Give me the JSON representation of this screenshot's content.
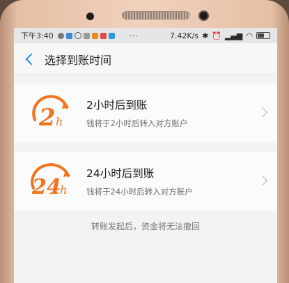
{
  "statusbar": {
    "time": "下午3:40",
    "dots": "···",
    "network_speed": "7.42K/s"
  },
  "navbar": {
    "title": "选择到账时间"
  },
  "options": [
    {
      "logo_number": "2",
      "logo_unit": "h",
      "title": "2小时后到账",
      "subtitle": "钱将于2小时后转入对方账户"
    },
    {
      "logo_number": "24",
      "logo_unit": "h",
      "title": "24小时后到账",
      "subtitle": "钱将于24小时后转入对方账户"
    }
  ],
  "note": "转账发起后，资金将无法撤回",
  "colors": {
    "accent": "#1e8fe1",
    "logo_orange": "#f2731c"
  },
  "icons": [
    "back-arrow-icon",
    "chevron-right-icon",
    "clock-2h-icon",
    "clock-24h-icon",
    "wifi-icon",
    "signal-icon",
    "battery-icon",
    "bluetooth-icon",
    "alarm-icon"
  ]
}
